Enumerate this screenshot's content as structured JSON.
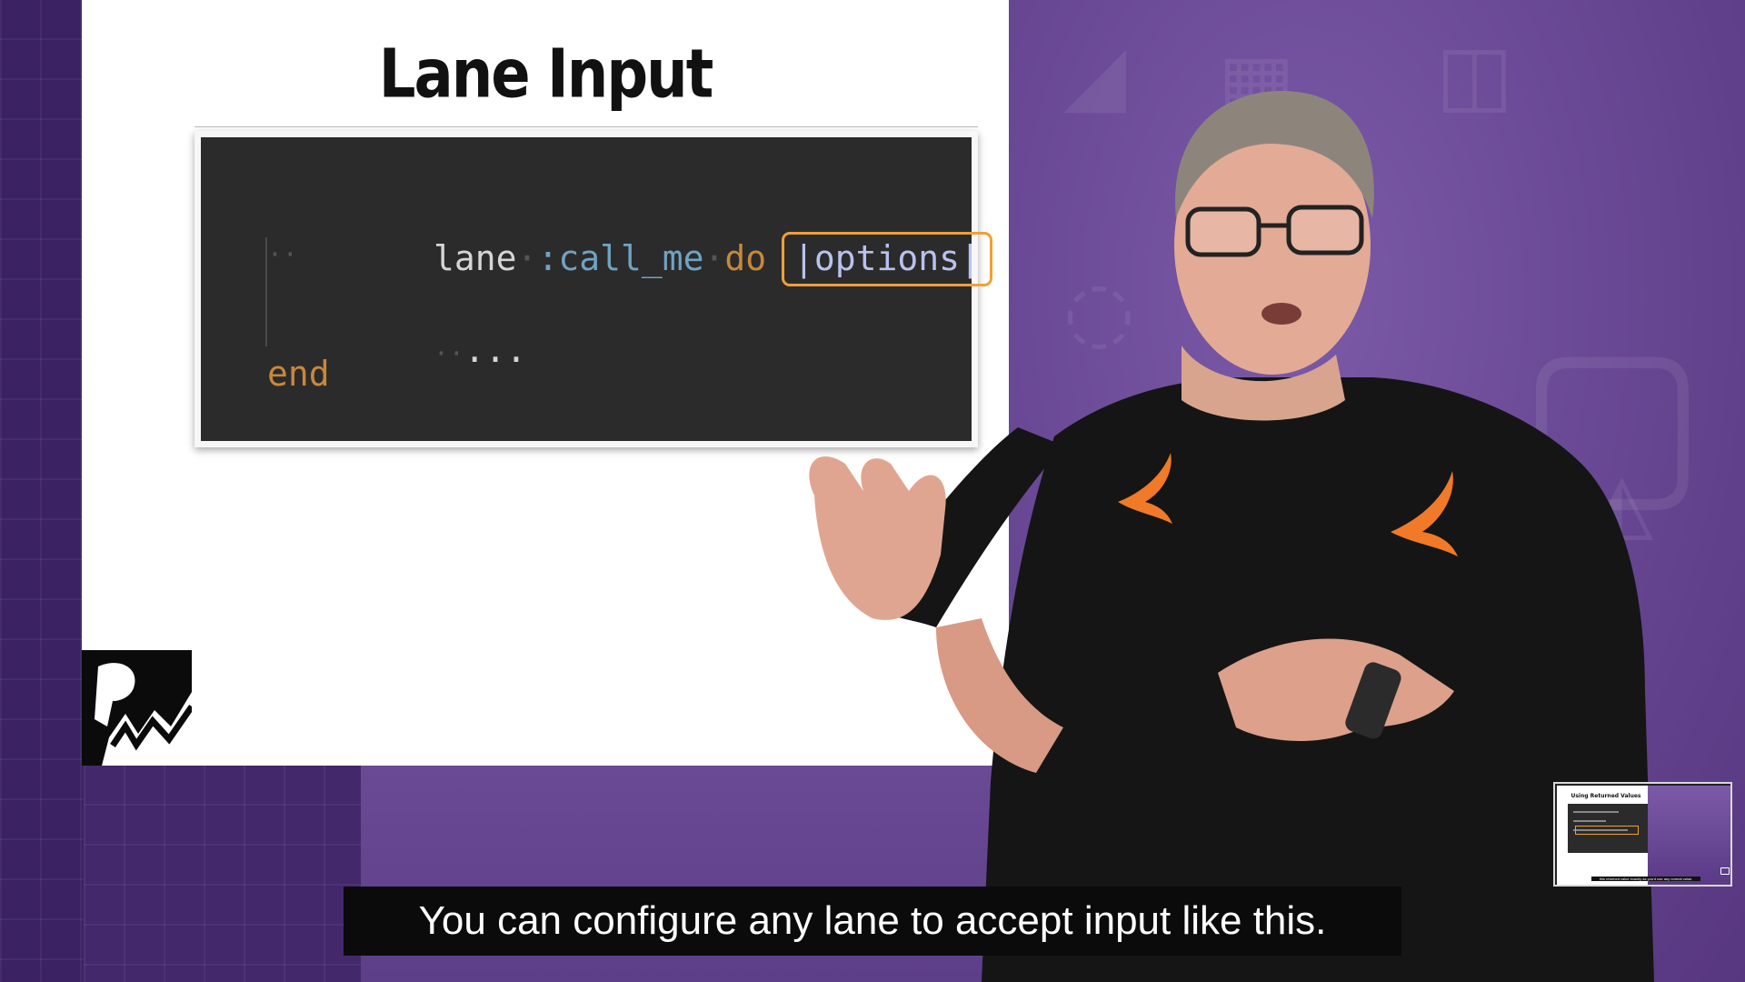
{
  "slide": {
    "title": "Lane Input",
    "code": {
      "line1": {
        "t_lane": "lane",
        "t_symbol": ":call_me",
        "t_do": "do",
        "t_param": "|options|"
      },
      "line2": "··",
      "line3_ws": "··",
      "line3_text": "...",
      "line4": "end"
    },
    "colors": {
      "highlight": "#f0a035",
      "keyword": "#c7883c",
      "symbol": "#6fa3c4",
      "param": "#b9c2ee",
      "code_bg": "#2b2b2b"
    }
  },
  "subtitle": "You can configure any lane to accept input like this.",
  "thumbnail": {
    "title": "Using Returned Values",
    "caption": "this returned value exactly as you'd use any normal value."
  },
  "icons": {
    "logo": "rw-logo",
    "shirt_logo": "swift-bird-icon",
    "thumb_icon": "screen-share-icon"
  }
}
